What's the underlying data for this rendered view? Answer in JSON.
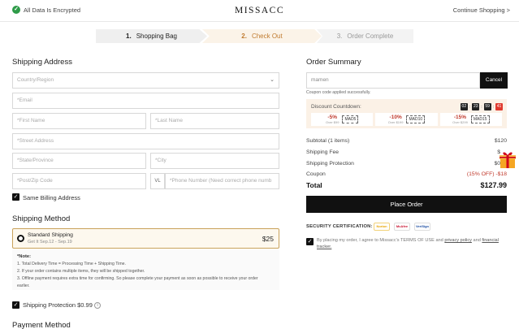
{
  "header": {
    "encrypted_text": "All Data Is Encrypted",
    "logo": "MISSACC",
    "continue_link": "Continue Shopping >"
  },
  "steps": [
    {
      "num": "1.",
      "label": "Shopping Bag"
    },
    {
      "num": "2.",
      "label": "Check Out"
    },
    {
      "num": "3.",
      "label": "Order Complete"
    }
  ],
  "shipping_address": {
    "title": "Shipping Address",
    "country_placeholder": "Country/Region",
    "email_placeholder": "*Email",
    "first_name_placeholder": "*First Name",
    "last_name_placeholder": "*Last Name",
    "street_placeholder": "*Street Address",
    "state_placeholder": "*State/Province",
    "city_placeholder": "*City",
    "zip_placeholder": "*Post/Zip Code",
    "phone_prefix": "VL",
    "phone_placeholder": "*Phone Number (Need correct phone numb",
    "same_billing_label": "Same Billing Address"
  },
  "shipping_method": {
    "title": "Shipping Method",
    "option_name": "Standard Shipping",
    "option_date": "Get It Sep.12 - Sep.19",
    "option_price": "$25",
    "note_title": "*Note:",
    "notes": [
      "1. Total Delivery Time = Processing Time + Shipping Time.",
      "2. If your order contains multiple items, they will be shipped together.",
      "3. Offline payment requires extra time for confirming. So please complete your payment as soon as possible to receive your order",
      "earlier."
    ],
    "protection_label": "Shipping Protection $0.99"
  },
  "payment_method": {
    "title": "Payment Method"
  },
  "order_summary": {
    "title": "Order Summary",
    "coupon_value": "mamen",
    "cancel_label": "Cancel",
    "coupon_msg": "Coupon code applied successfully.",
    "discount_title": "Discount Countdown:",
    "countdown": [
      "02",
      "23",
      "59",
      "41"
    ],
    "tiers": [
      {
        "pct": "-5%",
        "over": "Over $99",
        "code": "MAD5"
      },
      {
        "pct": "-10%",
        "over": "Over $199",
        "code": "MAD10"
      },
      {
        "pct": "-15%",
        "over": "Over $299",
        "code": "MAD15"
      }
    ],
    "rows": [
      {
        "label": "Subtotal (1 items)",
        "value": "$120"
      },
      {
        "label": "Shipping Fee",
        "value": "$"
      },
      {
        "label": "Shipping Protection",
        "value": "$0"
      },
      {
        "label": "Coupon",
        "value": "(15% OFF) -$18"
      }
    ],
    "total_label": "Total",
    "total_value": "$127.99",
    "place_order": "Place Order",
    "security_label": "SECURITY CERTIFICATION:",
    "badges": [
      "Norton",
      "McAfee",
      "VeriSign"
    ],
    "agree_text": "By placing my order, I agree to Missacc's TERMS OF USE and",
    "privacy_link": "privacy policy",
    "and_text": "and",
    "financial_link": "financial",
    "tracker_link": "tracker."
  },
  "colors": {
    "accent": "#c07b2f",
    "coupon_red": "#c0392b",
    "primary_button": "#111111"
  }
}
